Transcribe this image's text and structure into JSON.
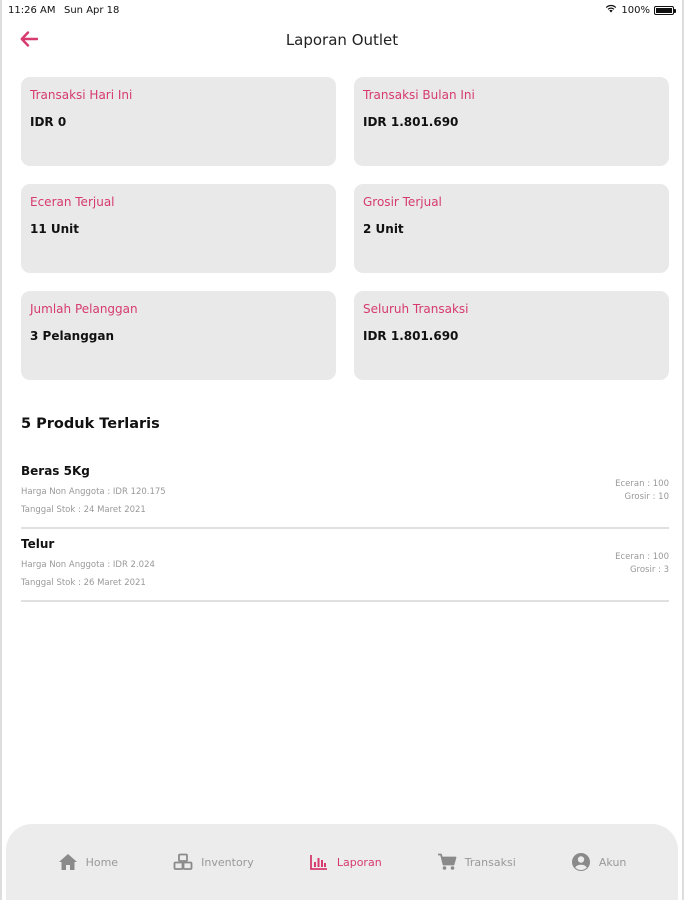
{
  "status_bar": {
    "time": "11:26 AM",
    "date": "Sun Apr 18",
    "battery": "100%"
  },
  "header": {
    "title": "Laporan Outlet",
    "back_icon": "arrow-left-icon"
  },
  "colors": {
    "accent": "#d63a6e",
    "card_bg": "#e9e9e9",
    "nav_bg": "#ececec"
  },
  "cards": [
    {
      "label": "Transaksi Hari Ini",
      "value": "IDR 0"
    },
    {
      "label": "Transaksi Bulan Ini",
      "value": "IDR 1.801.690"
    },
    {
      "label": "Eceran Terjual",
      "value": "11 Unit"
    },
    {
      "label": "Grosir Terjual",
      "value": "2 Unit"
    },
    {
      "label": "Jumlah Pelanggan",
      "value": "3 Pelanggan"
    },
    {
      "label": "Seluruh Transaksi",
      "value": "IDR 1.801.690"
    }
  ],
  "top_products": {
    "title": "5 Produk Terlaris",
    "items": [
      {
        "name": "Beras 5Kg",
        "price": "Harga Non Anggota : IDR 120.175",
        "stock_date": "Tanggal Stok : 24 Maret 2021",
        "eceran": "Eceran : 100",
        "grosir": "Grosir : 10"
      },
      {
        "name": "Telur",
        "price": "Harga Non Anggota : IDR 2.024",
        "stock_date": "Tanggal Stok : 26 Maret 2021",
        "eceran": "Eceran : 100",
        "grosir": "Grosir : 3"
      }
    ]
  },
  "nav": {
    "items": [
      {
        "label": "Home",
        "icon": "home-icon",
        "active": false
      },
      {
        "label": "Inventory",
        "icon": "inventory-icon",
        "active": false
      },
      {
        "label": "Laporan",
        "icon": "bar-chart-icon",
        "active": true
      },
      {
        "label": "Transaksi",
        "icon": "cart-icon",
        "active": false
      },
      {
        "label": "Akun",
        "icon": "account-icon",
        "active": false
      }
    ]
  }
}
